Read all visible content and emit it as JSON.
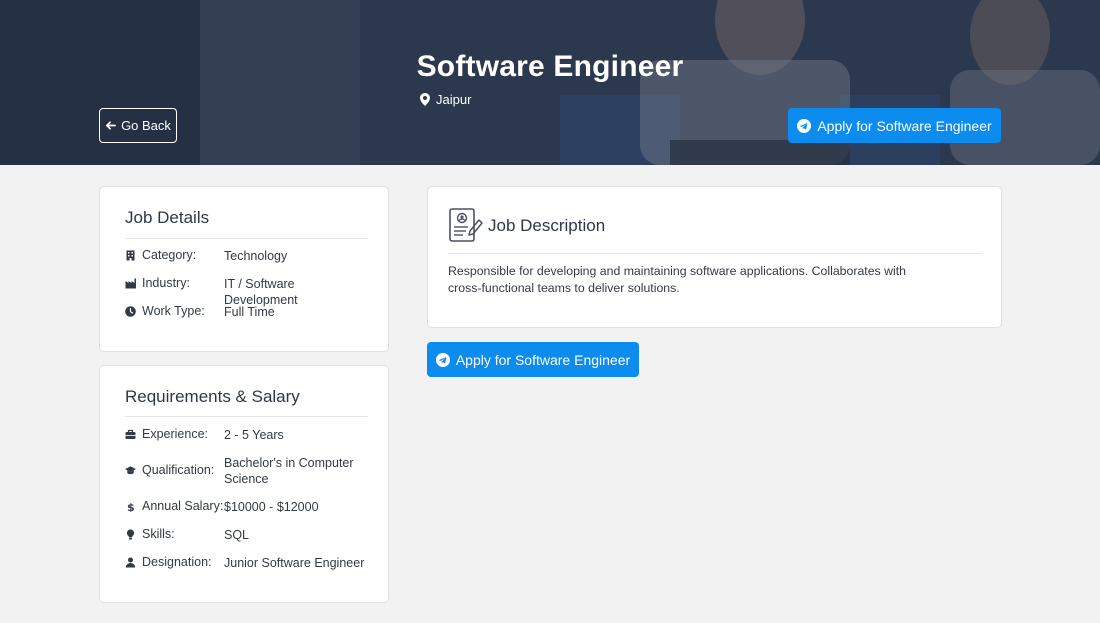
{
  "hero": {
    "title": "Software Engineer",
    "location": "Jaipur",
    "go_back_label": "Go Back",
    "apply_label": "Apply for Software Engineer"
  },
  "job_details": {
    "title": "Job Details",
    "rows": [
      {
        "icon": "building-icon",
        "label": "Category:",
        "value": "Technology"
      },
      {
        "icon": "industry-icon",
        "label": "Industry:",
        "value": "IT / Software Development"
      },
      {
        "icon": "clock-icon",
        "label": "Work Type:",
        "value": "Full Time"
      }
    ]
  },
  "requirements": {
    "title": "Requirements & Salary",
    "rows": [
      {
        "icon": "briefcase-icon",
        "label": "Experience:",
        "value": "2 - 5 Years"
      },
      {
        "icon": "graduation-cap-icon",
        "label": "Qualification:",
        "value": "Bachelor's in Computer Science"
      },
      {
        "icon": "dollar-icon",
        "label": "Annual Salary:",
        "value": "$10000 - $12000"
      },
      {
        "icon": "lightbulb-icon",
        "label": "Skills:",
        "value": "SQL"
      },
      {
        "icon": "user-icon",
        "label": "Designation:",
        "value": "Junior Software Engineer"
      }
    ]
  },
  "description": {
    "title": "Job Description",
    "icon": "resume-icon",
    "text": "Responsible for developing and maintaining software applications. Collaborates with cross-functional teams to deliver solutions."
  },
  "main": {
    "apply_label": "Apply for Software Engineer"
  },
  "colors": {
    "accent": "#0d8cf0",
    "hero_overlay": "#222e44",
    "page_bg": "#f2f2f2"
  }
}
